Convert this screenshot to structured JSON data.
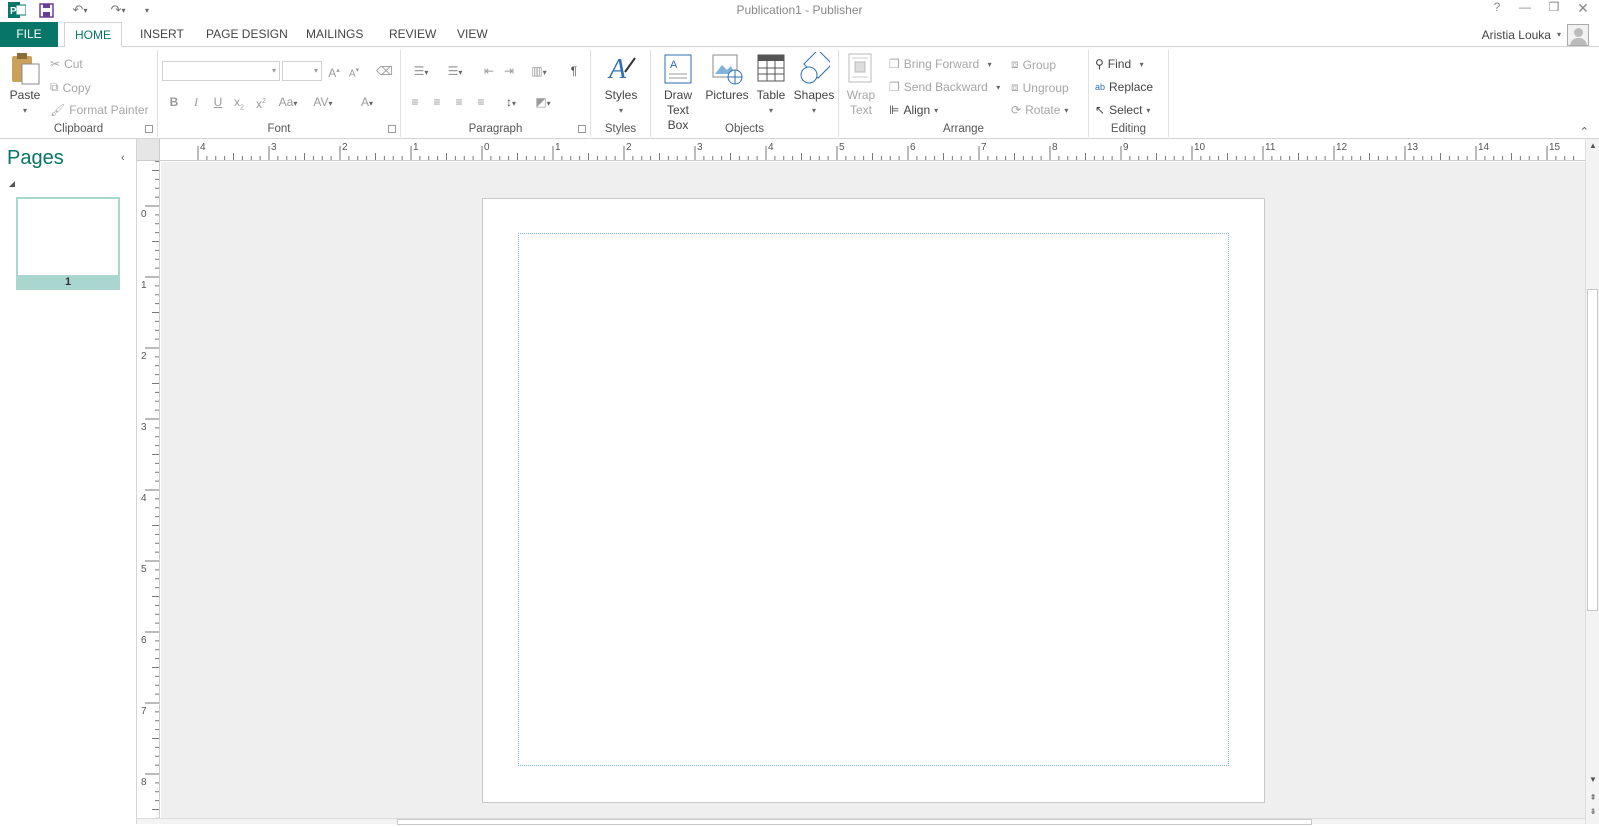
{
  "window": {
    "title": "Publication1 - Publisher"
  },
  "tabs": [
    "FILE",
    "HOME",
    "INSERT",
    "PAGE DESIGN",
    "MAILINGS",
    "REVIEW",
    "VIEW"
  ],
  "active_tab": "HOME",
  "user": {
    "name": "Aristia Louka"
  },
  "ribbon": {
    "clipboard": {
      "label": "Clipboard",
      "paste": "Paste",
      "cut": "Cut",
      "copy": "Copy",
      "format_painter": "Format Painter"
    },
    "font": {
      "label": "Font"
    },
    "paragraph": {
      "label": "Paragraph"
    },
    "styles": {
      "label": "Styles",
      "button": "Styles"
    },
    "objects": {
      "label": "Objects",
      "draw_text_box": [
        "Draw",
        "Text Box"
      ],
      "pictures": "Pictures",
      "table": "Table",
      "shapes": "Shapes"
    },
    "arrange": {
      "label": "Arrange",
      "wrap_text": [
        "Wrap",
        "Text"
      ],
      "bring_forward": "Bring Forward",
      "send_backward": "Send Backward",
      "align": "Align",
      "group": "Group",
      "ungroup": "Ungroup",
      "rotate": "Rotate"
    },
    "editing": {
      "label": "Editing",
      "find": "Find",
      "replace": "Replace",
      "select": "Select"
    }
  },
  "pages_pane": {
    "title": "Pages",
    "thumb_number": "1"
  },
  "rulers": {
    "horizontal": [
      "4",
      "3",
      "2",
      "1",
      "0",
      "1",
      "2",
      "3",
      "4",
      "5",
      "6",
      "7",
      "8",
      "9",
      "10",
      "11",
      "12",
      "13",
      "14",
      "15"
    ],
    "vertical": [
      "0",
      "1",
      "2",
      "3",
      "4",
      "5",
      "6",
      "7",
      "8"
    ]
  },
  "colors": {
    "accent": "#077568",
    "thumb_bg": "#a9d6cf",
    "margin_guide": "#7fb3d9"
  }
}
